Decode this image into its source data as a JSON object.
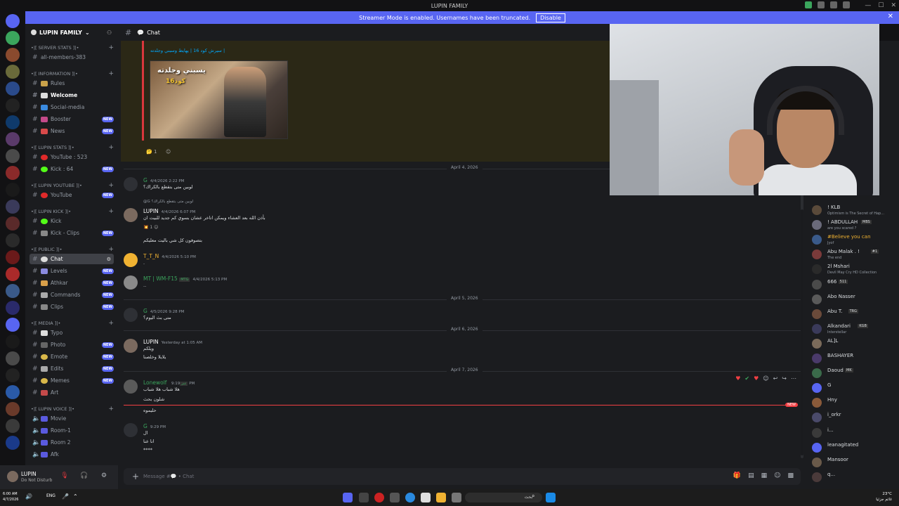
{
  "window": {
    "title": "LUPIN FAMILY"
  },
  "banner": {
    "text": "Streamer Mode is enabled. Usernames have been truncated.",
    "button": "Disable"
  },
  "server": {
    "name": "LUPIN FAMILY"
  },
  "sidebar": {
    "categories": [
      {
        "label": "•|[ SERVER STATS ]|•"
      },
      {
        "label": "•|[ INFORMATION ]|•"
      },
      {
        "label": "•|[ LUPIN STATS ]|•"
      },
      {
        "label": "•|[ LUPIN YOUTUBE ]|•"
      },
      {
        "label": "•|[ LUPIN KICK ]|•"
      },
      {
        "label": "•|[ PUBLIC ]|•"
      },
      {
        "label": "•|[ MEDIA ]|•"
      },
      {
        "label": "•|[ LUPIN VOICE ]|•"
      }
    ],
    "channels": [
      {
        "label": "all-members-383"
      },
      {
        "label": "Rules"
      },
      {
        "label": "Welcome"
      },
      {
        "label": "Social-media"
      },
      {
        "label": "Booster"
      },
      {
        "label": "News"
      },
      {
        "label": "YouTube : 523"
      },
      {
        "label": "Kick : 64"
      },
      {
        "label": "YouTube"
      },
      {
        "label": "Kick"
      },
      {
        "label": "Kick - Clips"
      },
      {
        "label": "Chat"
      },
      {
        "label": "Levels"
      },
      {
        "label": "Athkar"
      },
      {
        "label": "Commands"
      },
      {
        "label": "Clips"
      },
      {
        "label": "Typo"
      },
      {
        "label": "Photo"
      },
      {
        "label": "Emote"
      },
      {
        "label": "Edits"
      },
      {
        "label": "Memes"
      },
      {
        "label": "Art"
      },
      {
        "label": "Movie"
      },
      {
        "label": "Room-1"
      },
      {
        "label": "Room 2"
      },
      {
        "label": "Afk"
      }
    ],
    "new_label": "NEW"
  },
  "user": {
    "name": "LUPIN",
    "status": "Do Not Disturb"
  },
  "channel": {
    "name": "Chat"
  },
  "embed": {
    "link": "سيرش كود 16 | يهايط وسبني وجلدته |",
    "image_title": "يسبني وجلدته",
    "image_sub": "كود16",
    "reaction_count": "1"
  },
  "dates": {
    "d1": "April 4, 2026",
    "d2": "April 5, 2026",
    "d3": "April 6, 2026",
    "d4": "April 7, 2026"
  },
  "messages": [
    {
      "name": "G",
      "time": "4/4/2026 2:22 PM",
      "lines": [
        "لوبين متى بتقطع بالكراك؟"
      ]
    },
    {
      "name": "LUPIN",
      "time": "4/4/2026 6:07 PM",
      "reply": "@G لوبين متى بتقطع بالكراك؟",
      "lines": [
        "بأذن الله بعد العشاء ويمكن اتاخر عشان بسوي كم جديد للبيت ان"
      ],
      "reaction": "1",
      "extra": "بتصوفون كل شي باليت معليكم"
    },
    {
      "name": "T_T_N",
      "time": "4/4/2026 5:10 PM",
      "lines": [
        "."
      ]
    },
    {
      "name": "MT | WM-F15",
      "tag": "MTG",
      "time": "4/4/2026 5:13 PM",
      "lines": [
        ".."
      ]
    },
    {
      "name": "G",
      "time": "4/5/2026 9:28 PM",
      "lines": [
        "متى بث اليوم؟"
      ]
    },
    {
      "name": "LUPIN",
      "time": "Yesterday at 1:05 AM",
      "lines": [
        "ويلكم",
        "يلايلا وخلصنا"
      ]
    },
    {
      "name": "Lonewolf",
      "tag": "عنز",
      "time": "9:19 PM",
      "lines": [
        "هلا شباب هلا شباب",
        "شلون بحث"
      ]
    },
    {
      "name": "",
      "time": "",
      "lines": [
        "حليموه"
      ]
    },
    {
      "name": "G",
      "time": "9:29 PM",
      "lines": [
        "ال",
        "انا عنا",
        "****"
      ]
    }
  ],
  "new_marker": "NEW",
  "composer": {
    "placeholder": "Message #💬 • Chat"
  },
  "members": [
    {
      "name": "! KLB",
      "status": "Optimism is The Secret of Hap..."
    },
    {
      "name": "! ABDULLAH",
      "tag": "MBS",
      "status": "are you scared ?"
    },
    {
      "name": "#Believe you can",
      "status": "Jyof"
    },
    {
      "name": "Abu Malak . !",
      "tag": "#1",
      "status": "The end"
    },
    {
      "name": "2l Mshari",
      "status": "Devil May Cry HD Collection"
    },
    {
      "name": "666",
      "tag": "511",
      "status": ""
    },
    {
      "name": "Abo Nasser",
      "status": ""
    },
    {
      "name": "Abu T.",
      "tag": "TRG",
      "status": ""
    },
    {
      "name": "Alkandari",
      "tag": "KGB",
      "status": "Interstellar"
    },
    {
      "name": "AL]L",
      "status": ""
    },
    {
      "name": "BASHAYER",
      "status": ""
    },
    {
      "name": "Daoud",
      "tag": "MK",
      "status": ""
    },
    {
      "name": "G",
      "status": ""
    },
    {
      "name": "Hny",
      "status": ""
    },
    {
      "name": "i_orkr",
      "status": ""
    },
    {
      "name": "i...",
      "status": ""
    },
    {
      "name": "leanagitated",
      "status": ""
    },
    {
      "name": "Mansoor",
      "status": ""
    },
    {
      "name": "q...",
      "status": ""
    }
  ],
  "taskbar": {
    "lang": "ENG",
    "left_time": "6:00 AM",
    "left_date": "4/7/2026",
    "weather": "23°C",
    "weather_desc": "غائم جزئيا",
    "search": "بحث"
  },
  "colors": {
    "brand": "#5865f2",
    "danger": "#f23f43",
    "online": "#23a55a",
    "mention_bg": "#2b2816"
  }
}
